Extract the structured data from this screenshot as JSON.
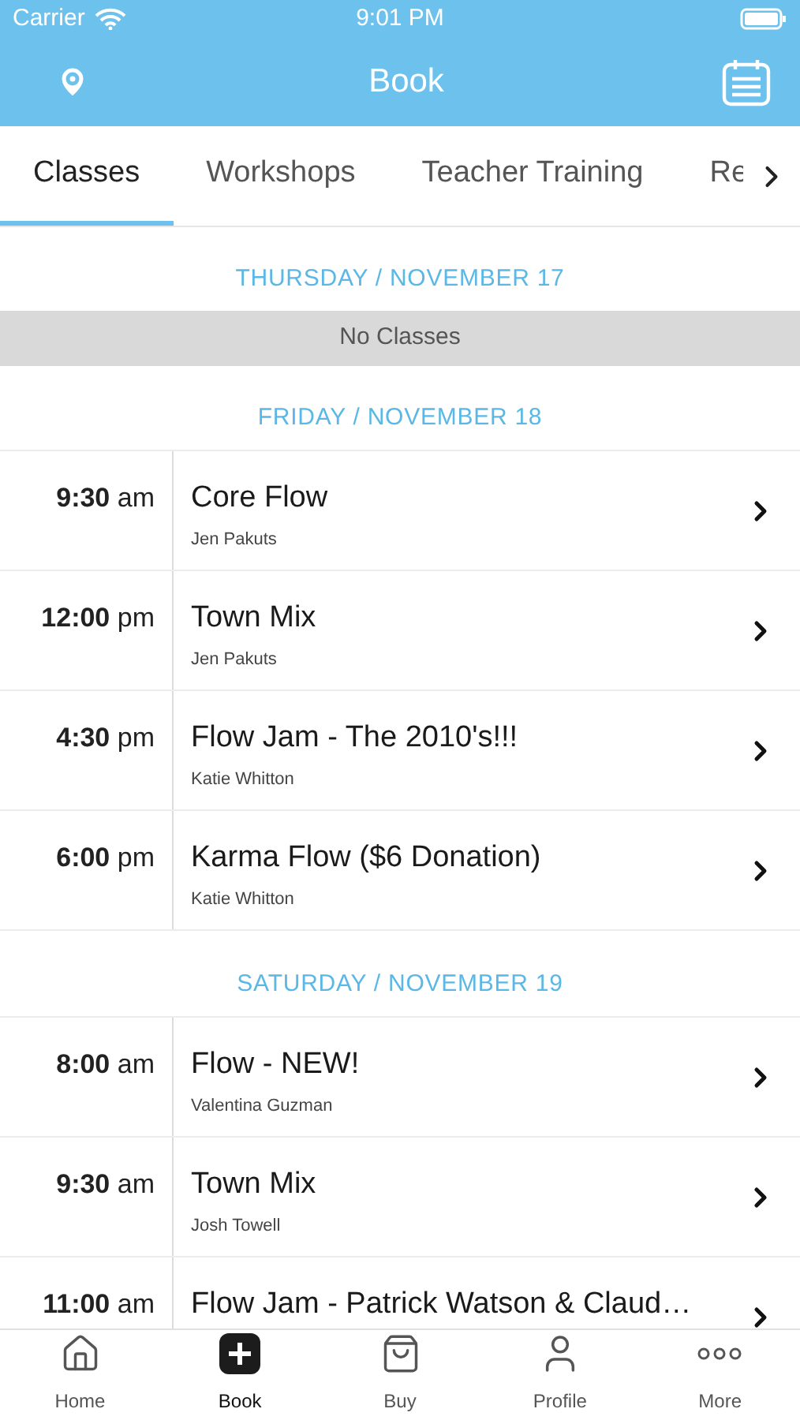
{
  "status_bar": {
    "carrier": "Carrier",
    "time": "9:01 PM"
  },
  "header": {
    "title": "Book"
  },
  "tabs": [
    {
      "label": "Classes",
      "selected": true
    },
    {
      "label": "Workshops",
      "selected": false
    },
    {
      "label": "Teacher Training",
      "selected": false
    },
    {
      "label": "Re",
      "selected": false
    }
  ],
  "days": [
    {
      "heading": "THURSDAY / NOVEMBER 17",
      "empty_text": "No Classes"
    },
    {
      "heading": "FRIDAY / NOVEMBER 18",
      "classes": [
        {
          "time": "9:30",
          "period": "am",
          "name": "Core Flow",
          "teacher": "Jen Pakuts"
        },
        {
          "time": "12:00",
          "period": "pm",
          "name": "Town Mix",
          "teacher": "Jen Pakuts"
        },
        {
          "time": "4:30",
          "period": "pm",
          "name": "Flow Jam - The 2010's!!!",
          "teacher": "Katie Whitton"
        },
        {
          "time": "6:00",
          "period": "pm",
          "name": "Karma Flow ($6 Donation)",
          "teacher": "Katie Whitton"
        }
      ]
    },
    {
      "heading": "SATURDAY / NOVEMBER 19",
      "classes": [
        {
          "time": "8:00",
          "period": "am",
          "name": "Flow - NEW!",
          "teacher": "Valentina Guzman"
        },
        {
          "time": "9:30",
          "period": "am",
          "name": "Town Mix",
          "teacher": "Josh Towell"
        },
        {
          "time": "11:00",
          "period": "am",
          "name": "Flow Jam - Patrick Watson & Claud…"
        }
      ]
    }
  ],
  "bottom_nav": [
    {
      "kind": "home",
      "label": "Home",
      "selected": false
    },
    {
      "kind": "book",
      "label": "Book",
      "selected": true
    },
    {
      "kind": "buy",
      "label": "Buy",
      "selected": false
    },
    {
      "kind": "profile",
      "label": "Profile",
      "selected": false
    },
    {
      "kind": "more",
      "label": "More",
      "selected": false
    }
  ]
}
